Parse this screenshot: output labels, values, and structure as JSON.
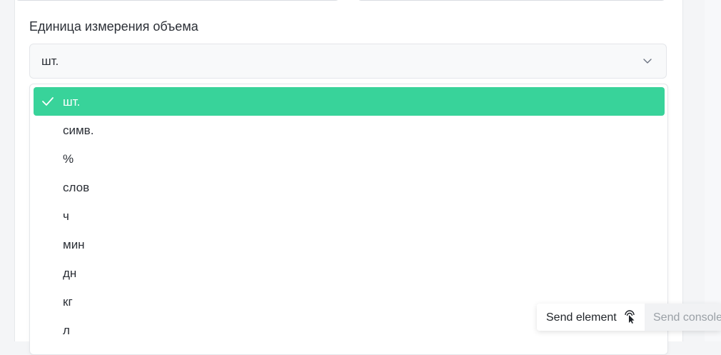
{
  "field": {
    "label": "Единица измерения объема",
    "selected_value": "шт."
  },
  "dropdown": {
    "options": [
      {
        "label": "шт.",
        "selected": true
      },
      {
        "label": "симв.",
        "selected": false
      },
      {
        "label": "%",
        "selected": false
      },
      {
        "label": "слов",
        "selected": false
      },
      {
        "label": "ч",
        "selected": false
      },
      {
        "label": "мин",
        "selected": false
      },
      {
        "label": "дн",
        "selected": false
      },
      {
        "label": "кг",
        "selected": false
      },
      {
        "label": "л",
        "selected": false
      }
    ]
  },
  "toolbar": {
    "send_element_label": "Send element",
    "send_console_label": "Send console"
  },
  "colors": {
    "accent": "#38d39a",
    "text": "#2b2f36",
    "muted": "#9aa0a6"
  },
  "icons": {
    "chevron": "chevron-down-icon",
    "check": "check-icon",
    "cursor": "pointer-cursor-icon"
  }
}
